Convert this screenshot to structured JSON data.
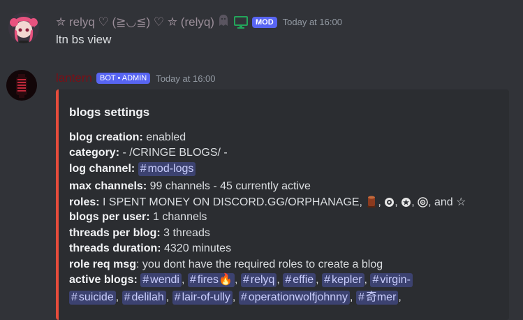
{
  "msg1": {
    "username": "✮ relyq ♡ (≧◡≦) ♡ ✮ (relyq)",
    "mod_badge": "MOD",
    "timestamp": "Today at 16:00",
    "text": "ltn bs view",
    "name_color": "#9b8e99"
  },
  "msg2": {
    "username": "lantern",
    "bot_badge": "BOT • ADMIN",
    "timestamp": "Today at 16:00",
    "name_color": "#7a0f17"
  },
  "embed": {
    "accent": "#e74c3c",
    "title": "blogs settings",
    "blog_creation_label": "blog creation:",
    "blog_creation_value": " enabled",
    "category_label": "category:",
    "category_value": " - /CRINGE BLOGS/ -",
    "log_channel_label": "log channel:",
    "log_channel_value": "mod-logs",
    "max_channels_label": "max channels:",
    "max_channels_value": " 99 channels - 45 currently active",
    "roles_label": "roles:",
    "roles_value": " I SPENT MONEY ON DISCORD.GG/ORPHANAGE,",
    "roles_sep1": ",",
    "roles_sep2": ",",
    "roles_sep3": ",",
    "roles_and": ", and ☆",
    "blogs_per_user_label": "blogs per user:",
    "blogs_per_user_value": " 1 channels",
    "threads_per_blog_label": "threads per blog:",
    "threads_per_blog_value": " 3 threads",
    "threads_duration_label": "threads duration:",
    "threads_duration_value": " 4320 minutes",
    "role_req_msg_label": "role req msg",
    "role_req_msg_value": ": you dont have the required roles to create a blog",
    "active_blogs_label": "active blogs:",
    "active_blogs_row1": [
      "wendi",
      "fires🔥",
      "relyq",
      "effie",
      "kepler",
      "virgin-"
    ],
    "active_blogs_row2": [
      "suicide",
      "delilah",
      "lair-of-ully",
      "operationwolfjohnny",
      "奇mer"
    ]
  }
}
